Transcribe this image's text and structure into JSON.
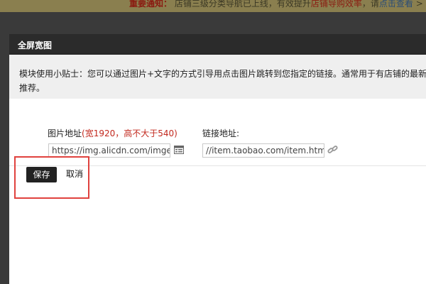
{
  "notice": {
    "label": "重要通知：",
    "text1": " 店铺三级分类导航已上线，有效提升",
    "highlight": "店铺导购效率",
    "text2": "，请",
    "link": "点击查看",
    "arrow": " >"
  },
  "dialog": {
    "title": "全屏宽图",
    "tip": "模块使用小贴士：您可以通过图片+文字的方式引导用点击图片跳转到您指定的链接。通常用于有店铺的最新活动推荐。",
    "image_field": {
      "label": "图片地址",
      "requirement": "(宽1920，高不大于540)",
      "value": "https://img.alicdn.com/imgextra/"
    },
    "link_field": {
      "label": "链接地址:",
      "value": "//item.taobao.com/item.htm?id="
    },
    "save_label": "保存",
    "cancel_label": "取消"
  },
  "colors": {
    "overlay": "#3a3a3a",
    "header": "#2b2b2b",
    "tip_bg": "#efefef",
    "annotation": "#e0423e"
  }
}
